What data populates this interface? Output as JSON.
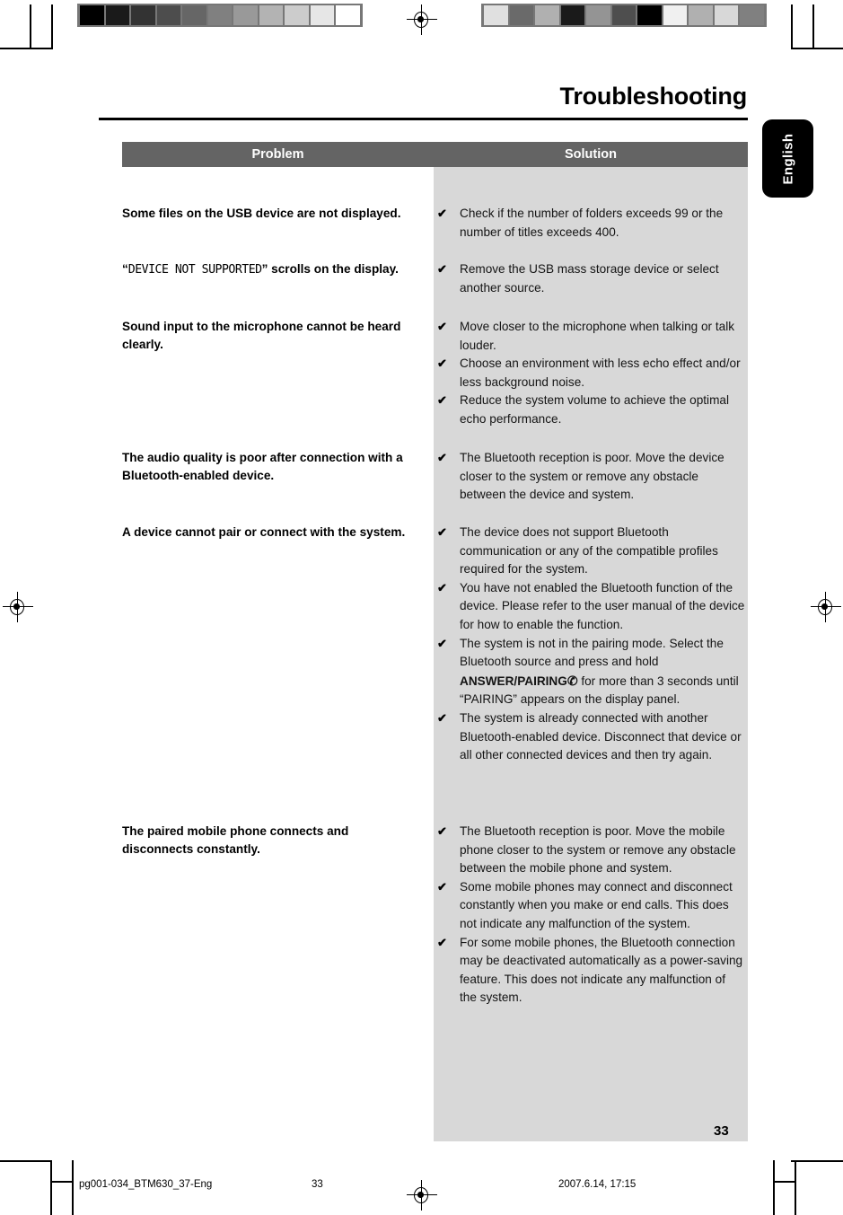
{
  "document": {
    "title": "Troubleshooting",
    "language_tab": "English",
    "page_number": "33"
  },
  "table": {
    "headers": {
      "problem": "Problem",
      "solution": "Solution"
    },
    "check_glyph": "✔",
    "rows": [
      {
        "problem_lines": [
          {
            "type": "bold",
            "text": "Some files on the USB device are not displayed."
          }
        ],
        "solutions": [
          "Check if the number of folders exceeds 99 or the number of titles exceeds 400."
        ]
      },
      {
        "problem_lines": [
          {
            "type": "quote-open",
            "text": "“"
          },
          {
            "type": "lcd",
            "text": "DEVICE NOT SUPPORTED"
          },
          {
            "type": "bold",
            "text": "” scrolls on the display."
          }
        ],
        "solutions": [
          "Remove the USB mass storage device or select another source."
        ]
      },
      {
        "problem_lines": [
          {
            "type": "bold",
            "text": "Sound input to the microphone cannot be heard clearly."
          }
        ],
        "solutions": [
          "Move closer to the microphone when talking or talk louder.",
          "Choose an environment with less echo effect and/or less background noise.",
          "Reduce the system volume to achieve the optimal echo performance."
        ]
      },
      {
        "problem_lines": [
          {
            "type": "bold",
            "text": "The audio quality is poor after connection with a Bluetooth-enabled device."
          }
        ],
        "solutions": [
          "The Bluetooth reception is poor. Move the device closer to the system or remove any obstacle between the device and system."
        ]
      },
      {
        "problem_lines": [
          {
            "type": "bold",
            "text": "A device cannot pair or connect with the system."
          }
        ],
        "solutions": [
          "The device does not support Bluetooth communication or any of the compatible profiles required for the system.",
          "You have not enabled the Bluetooth function of the device. Please refer to the user manual of the device for how to enable the function.",
          "PAIRING_SPECIAL",
          "The system is already connected with another Bluetooth-enabled device. Disconnect that device or all other connected devices and then try again."
        ],
        "pairing_solution": {
          "before": "The system is not in the pairing mode. Select the Bluetooth source and press and hold ",
          "button_label": "ANSWER/PAIRING",
          "button_icon": "phone-handset-icon",
          "button_icon_glyph": "✆",
          "after": " for more than 3 seconds until “PAIRING” appears on the display panel."
        }
      },
      {
        "problem_lines": [
          {
            "type": "bold",
            "text": "The paired mobile phone connects and disconnects constantly."
          }
        ],
        "solutions": [
          "The Bluetooth reception is poor. Move the mobile phone closer to the system or remove any obstacle between the mobile phone and system.",
          "Some mobile phones may connect and disconnect constantly when you make or end calls. This does not indicate any malfunction of the system.",
          "For some mobile phones, the Bluetooth connection may be deactivated automatically as a power-saving feature. This does not indicate any malfunction of the system."
        ]
      }
    ]
  },
  "print_marks": {
    "calibration_left": [
      "#000000",
      "#1a1a1a",
      "#333333",
      "#4d4d4d",
      "#666666",
      "#808080",
      "#999999",
      "#b3b3b3",
      "#cccccc",
      "#e6e6e6",
      "#ffffff"
    ],
    "calibration_right": [
      "#e0e0e0",
      "#6a6a6a",
      "#b0b0b0",
      "#1a1a1a",
      "#949494",
      "#4e4e4e",
      "#000000",
      "#f0f0f0",
      "#b0b0b0",
      "#d8d8d8",
      "#808080"
    ],
    "registration_icon": "registration-target-icon"
  },
  "footer": {
    "file_name": "pg001-034_BTM630_37-Eng",
    "page": "33",
    "timestamp": "2007.6.14, 17:15"
  },
  "colors": {
    "header_bar": "#646464",
    "solution_background": "#d8d8d8",
    "tab_background": "#000000",
    "text": "#000000"
  }
}
